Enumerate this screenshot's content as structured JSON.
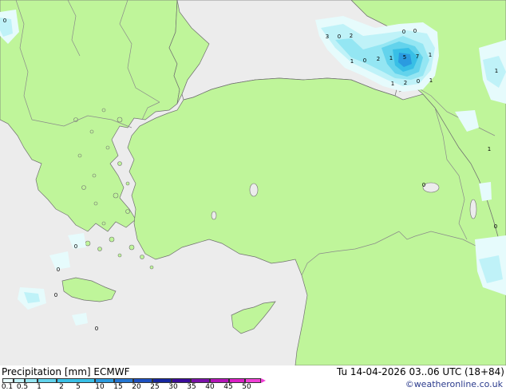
{
  "header": {
    "product": "Precipitation [mm]",
    "model": "ECMWF",
    "valid_time": "Tu 14-04-2026 03..06 UTC (18+84)",
    "credit": "©weatheronline.co.uk"
  },
  "colors": {
    "land": "#bff59a",
    "sea": "#ececec",
    "border": "#8a8a8a",
    "coast": "#707070"
  },
  "legend": {
    "labels": [
      "0.1",
      "0.5",
      "1",
      "2",
      "5",
      "10",
      "15",
      "20",
      "25",
      "30",
      "35",
      "40",
      "45",
      "50"
    ],
    "colors": [
      "#e6fbfc",
      "#bff2f8",
      "#94e6f3",
      "#63d3ec",
      "#38bfe6",
      "#2a9be0",
      "#2476d2",
      "#1c4fc0",
      "#16259f",
      "#3a0a9a",
      "#7a10a8",
      "#b414b8",
      "#dc1ec6",
      "#f040d6"
    ]
  },
  "precip_values": [
    "3",
    "0",
    "2",
    "0",
    "0",
    "1",
    "0",
    "2",
    "1",
    "5",
    "7",
    "1",
    "1",
    "2",
    "0",
    "1",
    "1",
    "1",
    "0",
    "0",
    "0",
    "0",
    "0",
    "0",
    "0"
  ]
}
